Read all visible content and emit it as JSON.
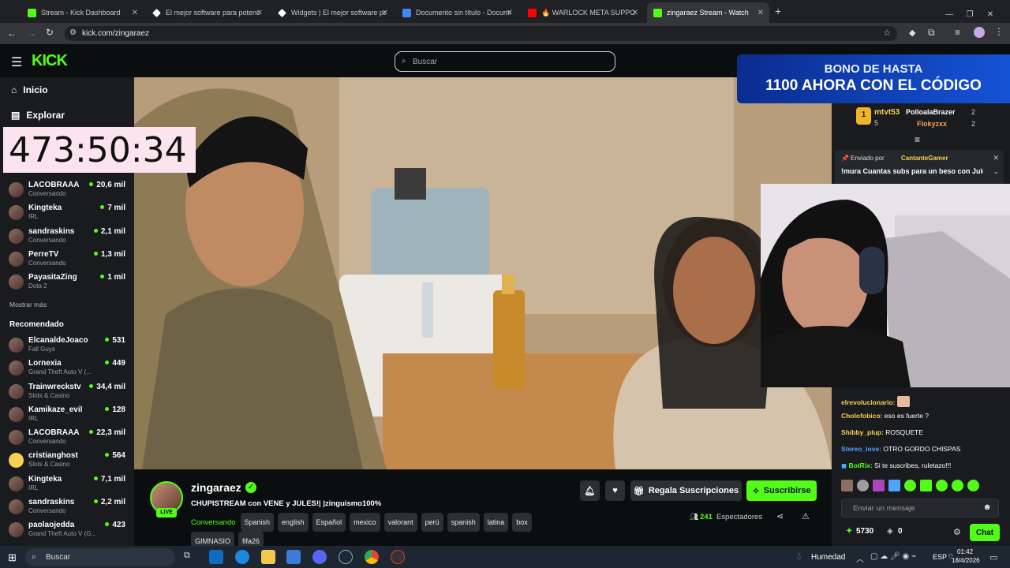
{
  "browser": {
    "tabs": [
      {
        "label": "Stream - Kick Dashboard",
        "color": "#53fc18"
      },
      {
        "label": "El mejor software para potencia",
        "color": "#ffffff"
      },
      {
        "label": "Widgets | El mejor software par",
        "color": "#ffffff"
      },
      {
        "label": "Documento sin título - Docume",
        "color": "#4285f4"
      },
      {
        "label": "🔥 WARLOCK META SUPPORT ·",
        "color": "#ff0000"
      },
      {
        "label": "zingaraez Stream - Watch L",
        "color": "#53fc18"
      }
    ],
    "url": "kick.com/zingaraez"
  },
  "kick": {
    "logo": "KICK",
    "search_placeholder": "Buscar",
    "nav": {
      "home": "Inicio",
      "explore": "Explorar"
    },
    "show_more": "Mostrar más",
    "recommended_title": "Recomendado",
    "following": [
      {
        "name": "LACOBRAAA",
        "sub": "Conversando",
        "viewers": "20,6 mil"
      },
      {
        "name": "Kingteka",
        "sub": "IRL",
        "viewers": "7 mil"
      },
      {
        "name": "sandraskins",
        "sub": "Conversando",
        "viewers": "2,1 mil"
      },
      {
        "name": "PerreTV",
        "sub": "Conversando",
        "viewers": "1,3 mil"
      },
      {
        "name": "PayasitaZing",
        "sub": "Dota 2",
        "viewers": "1 mil"
      }
    ],
    "recommended": [
      {
        "name": "ElcanaldeJoaco",
        "sub": "Fall Guys",
        "viewers": "531"
      },
      {
        "name": "Lornexia",
        "sub": "Grand Theft Auto V (...",
        "viewers": "449"
      },
      {
        "name": "Trainwreckstv",
        "sub": "Slots & Casino",
        "viewers": "34,4 mil"
      },
      {
        "name": "Kamikaze_evil",
        "sub": "IRL",
        "viewers": "128"
      },
      {
        "name": "LACOBRAAA",
        "sub": "Conversando",
        "viewers": "22,3 mil"
      },
      {
        "name": "cristianghost",
        "sub": "Slots & Casino",
        "viewers": "564"
      },
      {
        "name": "Kingteka",
        "sub": "IRL",
        "viewers": "7,1 mil"
      },
      {
        "name": "sandraskins",
        "sub": "Conversando",
        "viewers": "2,2 mil"
      },
      {
        "name": "paolaojedda",
        "sub": "Grand Theft Auto V (G...",
        "viewers": "423"
      }
    ]
  },
  "overlay": {
    "timer": "473:50:34",
    "banner_line1": "BONO DE HASTA",
    "banner_line2": "1100 AHORA CON EL CÓDIGO"
  },
  "stream": {
    "channel": "zingaraez",
    "live_label": "LIVE",
    "title": "CHUPISTREAM con VENE y JULES!| |zinguismo100%",
    "category": "Conversando",
    "tags": [
      "Spanish",
      "english",
      "Español",
      "mexico",
      "valorant",
      "perú",
      "spanish",
      "latina",
      "box",
      "GIMNASIO",
      "fifa26"
    ],
    "gift_label": "Regala Suscripciones",
    "subscribe_label": "Suscribirse",
    "viewers_count": "241",
    "viewers_label": "Espectadores"
  },
  "chat": {
    "top": [
      {
        "rank": "1",
        "name": "mtvt53",
        "count": "5"
      },
      {
        "name": "PolloalaBrazer",
        "count": "2"
      },
      {
        "name": "Flokyzxx",
        "count": "2"
      }
    ],
    "pinned_by_prefix": "Enviado por",
    "pinned_by": "CantanteGamer",
    "pinned_text": "!mura Cuantas subs para un beso con Jules",
    "messages": [
      {
        "user": "elrevolucionario:",
        "text": "",
        "color": "#f7d154"
      },
      {
        "user": "Cholofobico:",
        "text": "eso es fuerte ?",
        "color": "#f7d154"
      },
      {
        "user": "Shibby_plup:",
        "text": "ROSQUETE",
        "color": "#f7d154"
      },
      {
        "user": "Stereo_love:",
        "text": "OTRO GORDO CHISPAS",
        "color": "#4fa3ff"
      },
      {
        "user": "BotRix:",
        "text": "Si te suscribes, ruletazo!!!",
        "color": "#53fc18"
      }
    ],
    "input_placeholder": "Enviar un mensaje",
    "points": "5730",
    "zero": "0",
    "chat_button": "Chat"
  },
  "taskbar": {
    "search": "Buscar",
    "weather": "Humedad",
    "lang": "ESP",
    "time": "01:42",
    "date": "18/4/2026"
  }
}
